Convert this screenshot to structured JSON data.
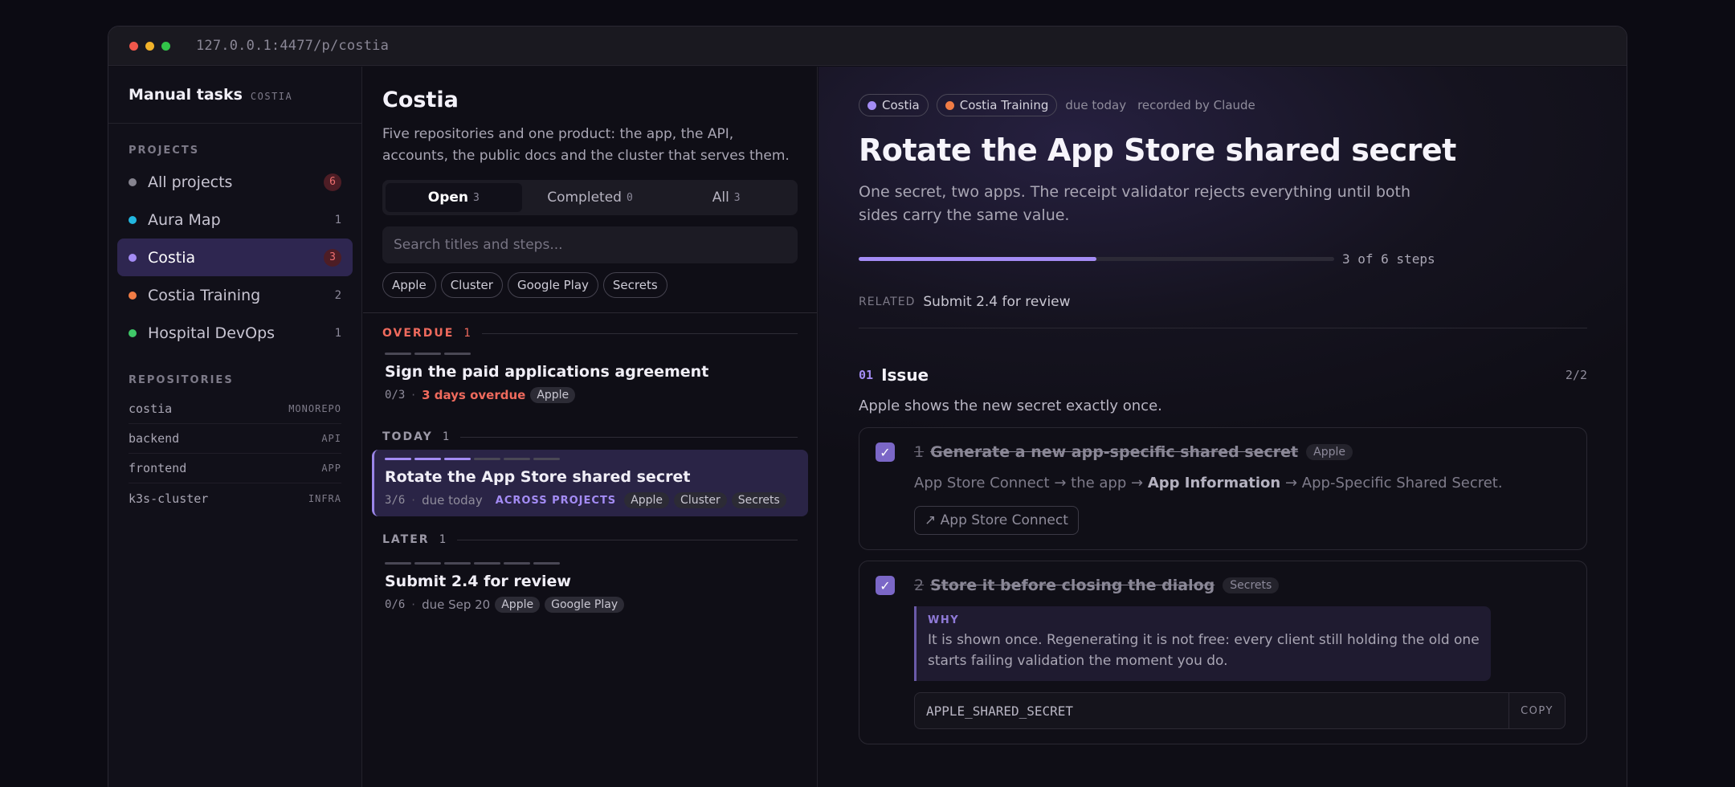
{
  "window": {
    "url": "127.0.0.1:4477/p/costia"
  },
  "sidebar": {
    "brand_title": "Manual tasks",
    "brand_sub": "COSTIA",
    "projects_label": "PROJECTS",
    "projects": [
      {
        "name": "All projects",
        "count": "6",
        "color": "#86848f",
        "badge": true,
        "active": false
      },
      {
        "name": "Aura Map",
        "count": "1",
        "color": "#22b7e0",
        "badge": false,
        "active": false
      },
      {
        "name": "Costia",
        "count": "3",
        "color": "#a48cf5",
        "badge": true,
        "active": true
      },
      {
        "name": "Costia Training",
        "count": "2",
        "color": "#f07c45",
        "badge": false,
        "active": false
      },
      {
        "name": "Hospital DevOps",
        "count": "1",
        "color": "#3fc868",
        "badge": false,
        "active": false
      }
    ],
    "repositories_label": "REPOSITORIES",
    "repositories": [
      {
        "name": "costia",
        "type": "MONOREPO"
      },
      {
        "name": "backend",
        "type": "API"
      },
      {
        "name": "frontend",
        "type": "APP"
      },
      {
        "name": "k3s-cluster",
        "type": "INFRA"
      }
    ]
  },
  "list": {
    "title": "Costia",
    "description": "Five repositories and one product: the app, the API, accounts, the public docs and the cluster that serves them.",
    "tabs": [
      {
        "label": "Open",
        "count": "3"
      },
      {
        "label": "Completed",
        "count": "0"
      },
      {
        "label": "All",
        "count": "3"
      }
    ],
    "search_placeholder": "Search titles and steps...",
    "filters": [
      "Apple",
      "Cluster",
      "Google Play",
      "Secrets"
    ],
    "groups": {
      "overdue": {
        "label": "OVERDUE",
        "count": "1"
      },
      "today": {
        "label": "TODAY",
        "count": "1"
      },
      "later": {
        "label": "LATER",
        "count": "1"
      }
    },
    "tasks": {
      "overdue": {
        "title": "Sign the paid applications agreement",
        "progress": "0/3",
        "due": "3 days overdue",
        "tags": [
          "Apple"
        ],
        "steps_total": 3,
        "steps_done": 0
      },
      "today": {
        "title": "Rotate the App Store shared secret",
        "progress": "3/6",
        "due": "due today",
        "scope": "ACROSS PROJECTS",
        "tags": [
          "Apple",
          "Cluster",
          "Secrets"
        ],
        "steps_total": 6,
        "steps_done": 3
      },
      "later": {
        "title": "Submit 2.4 for review",
        "progress": "0/6",
        "due": "due Sep 20",
        "tags": [
          "Apple",
          "Google Play"
        ],
        "steps_total": 6,
        "steps_done": 0
      }
    }
  },
  "detail": {
    "projects": [
      {
        "name": "Costia",
        "color": "#a48cf5"
      },
      {
        "name": "Costia Training",
        "color": "#f07c45"
      }
    ],
    "due": "due today",
    "recorded": "recorded by Claude",
    "title": "Rotate the App Store shared secret",
    "description": "One secret, two apps. The receipt validator rejects everything until both sides carry the same value.",
    "progress_label": "3 of 6 steps",
    "progress_fraction": 0.5,
    "related_label": "RELATED",
    "related_link": "Submit 2.4 for review",
    "issue": {
      "num": "01",
      "title": "Issue",
      "count": "2/2",
      "description": "Apple shows the new secret exactly once."
    },
    "steps": [
      {
        "num": "1",
        "title": "Generate a new app-specific shared secret",
        "tag": "Apple",
        "path_start": "App Store Connect → the app →",
        "path_bold": "App Information",
        "path_end": "→ App-Specific Shared Secret.",
        "button": "↗ App Store Connect"
      },
      {
        "num": "2",
        "title": "Store it before closing the dialog",
        "tag": "Secrets",
        "why_label": "WHY",
        "why_text": "It is shown once. Regenerating it is not free: every client still holding the old one starts failing validation the moment you do.",
        "secret": "APPLE_SHARED_SECRET",
        "copy": "COPY"
      }
    ]
  }
}
